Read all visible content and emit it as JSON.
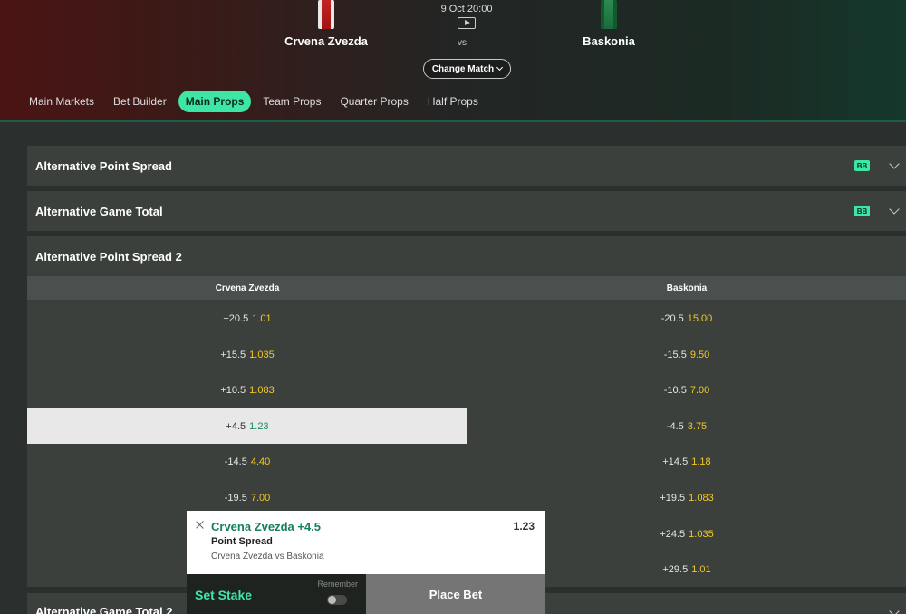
{
  "event": {
    "home_team": "Crvena Zvezda",
    "away_team": "Baskonia",
    "datetime": "9 Oct 20:00",
    "vs": "vs",
    "change_match_label": "Change Match",
    "home_jersey_icon": "red-jersey-icon",
    "away_jersey_icon": "green-jersey-icon"
  },
  "tabs": [
    {
      "label": "Main Markets",
      "active": false
    },
    {
      "label": "Bet Builder",
      "active": false
    },
    {
      "label": "Main Props",
      "active": true
    },
    {
      "label": "Team Props",
      "active": false
    },
    {
      "label": "Quarter Props",
      "active": false
    },
    {
      "label": "Half Props",
      "active": false
    }
  ],
  "markets": {
    "alt_point_spread": {
      "title": "Alternative Point Spread",
      "badge": "BB"
    },
    "alt_game_total": {
      "title": "Alternative Game Total",
      "badge": "BB"
    },
    "alt_point_spread_2": {
      "title": "Alternative Point Spread 2",
      "col_home": "Crvena Zvezda",
      "col_away": "Baskonia",
      "rows": [
        {
          "home_line": "+20.5",
          "home_price": "1.01",
          "away_line": "-20.5",
          "away_price": "15.00"
        },
        {
          "home_line": "+15.5",
          "home_price": "1.035",
          "away_line": "-15.5",
          "away_price": "9.50"
        },
        {
          "home_line": "+10.5",
          "home_price": "1.083",
          "away_line": "-10.5",
          "away_price": "7.00"
        },
        {
          "home_line": "+4.5",
          "home_price": "1.23",
          "away_line": "-4.5",
          "away_price": "3.75"
        },
        {
          "home_line": "-14.5",
          "home_price": "4.40",
          "away_line": "+14.5",
          "away_price": "1.18"
        },
        {
          "home_line": "-19.5",
          "home_price": "7.00",
          "away_line": "+19.5",
          "away_price": "1.083"
        },
        {
          "home_line": "",
          "home_price": "",
          "away_line": "+24.5",
          "away_price": "1.035"
        },
        {
          "home_line": "",
          "home_price": "",
          "away_line": "+29.5",
          "away_price": "1.01"
        }
      ]
    },
    "alt_game_total_2": {
      "title": "Alternative Game Total 2"
    }
  },
  "betslip": {
    "selection": "Crvena Zvezda +4.5",
    "odds": "1.23",
    "market": "Point Spread",
    "event": "Crvena Zvezda vs Baskonia",
    "set_stake_label": "Set Stake",
    "remember_label": "Remember",
    "place_bet_label": "Place Bet"
  },
  "colors": {
    "accent": "#3ee6a6",
    "price": "#f3c824",
    "selected_price": "#1a8a5c"
  }
}
